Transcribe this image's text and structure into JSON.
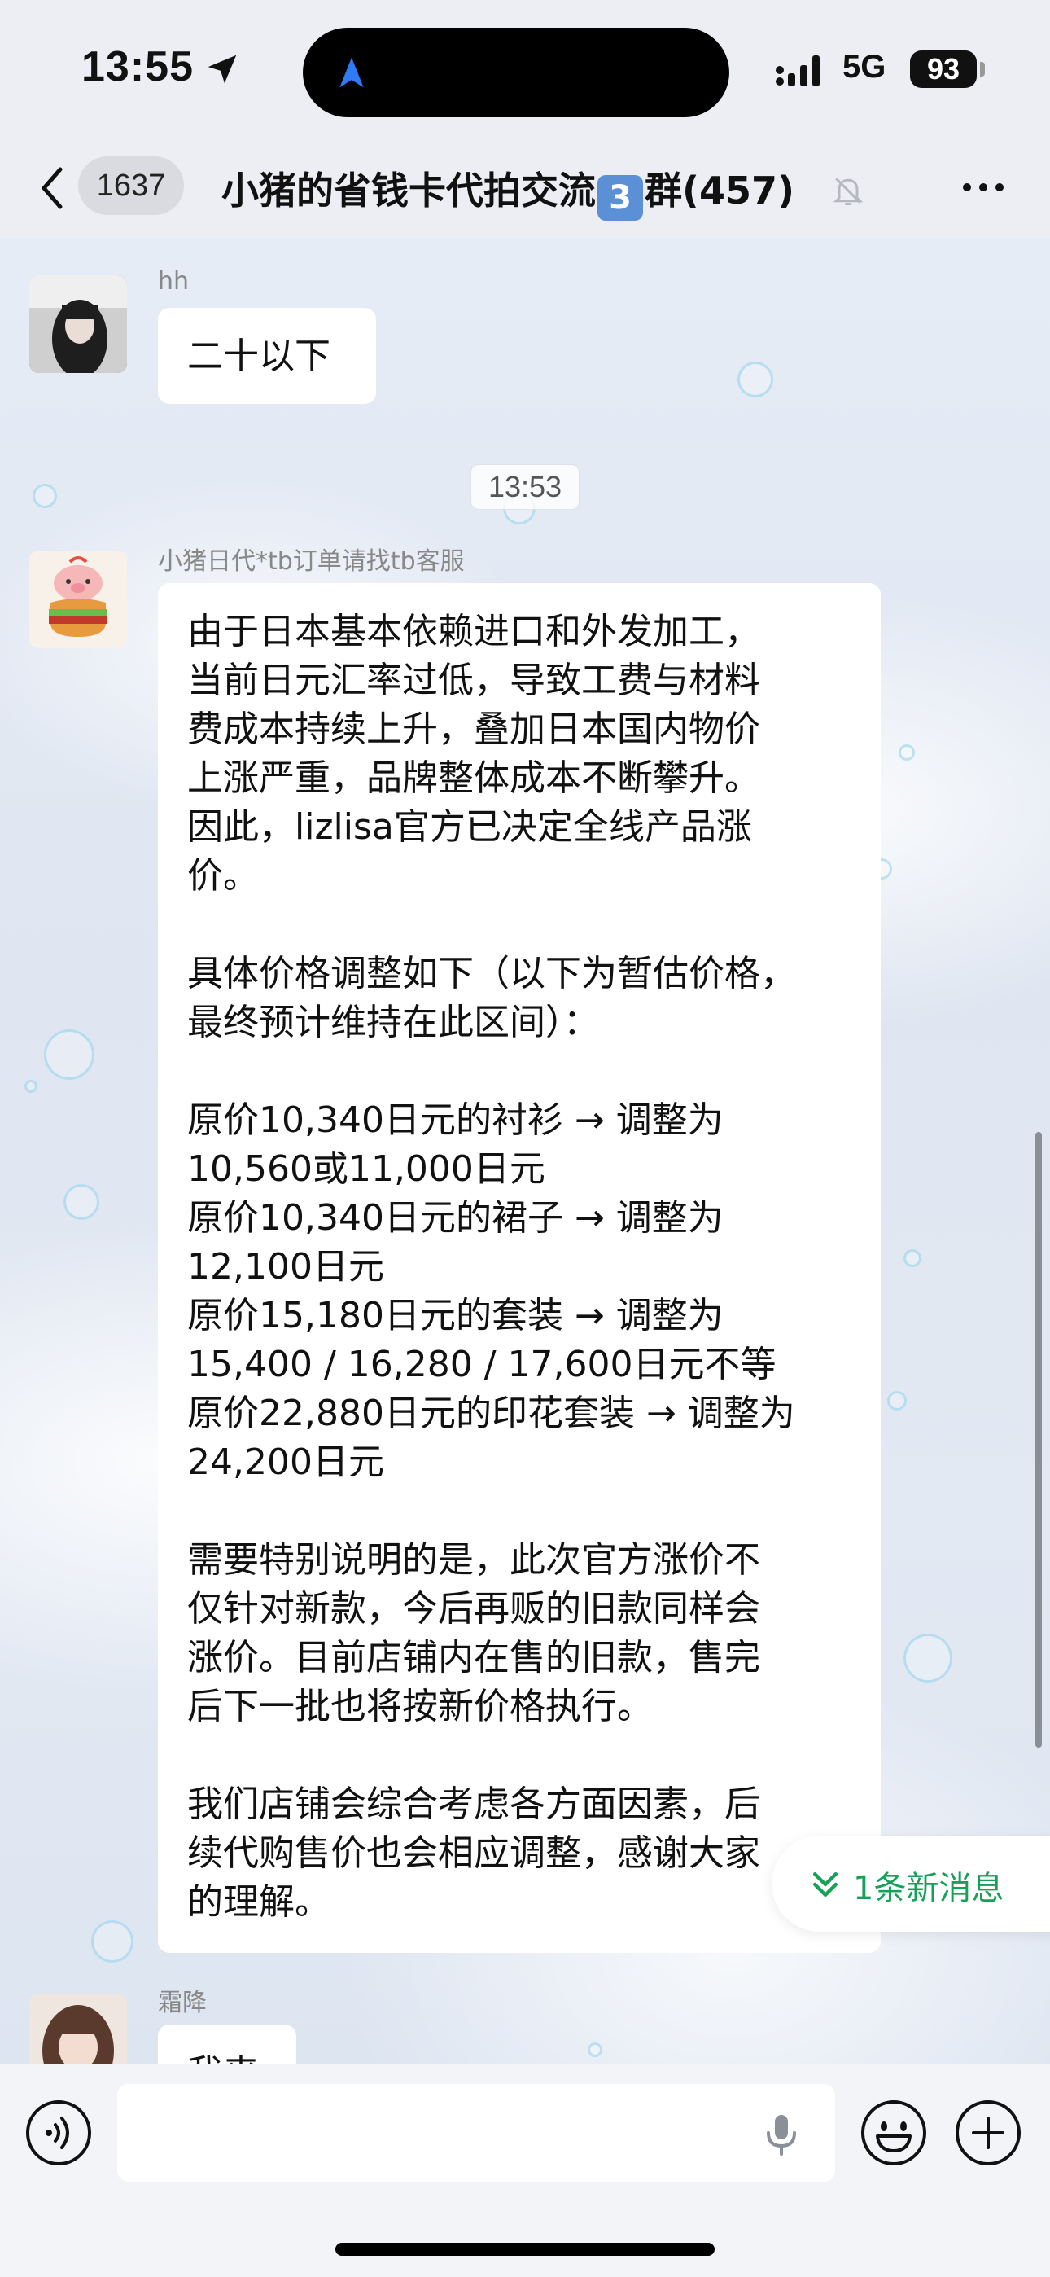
{
  "status_bar": {
    "time": "13:55",
    "network": "5G",
    "battery": "93"
  },
  "header": {
    "unread_count": "1637",
    "title_prefix": "小猪的省钱卡代拍交流",
    "title_badge": "3",
    "title_suffix": "群(457)"
  },
  "messages": [
    {
      "sender": "hh",
      "lines": [
        "二十以下"
      ]
    },
    {
      "timestamp": "13:53"
    },
    {
      "sender": "小猪日代*tb订单请找tb客服",
      "lines": [
        "由于日本基本依赖进口和外发加工，",
        "当前日元汇率过低，导致工费与材料",
        "费成本持续上升，叠加日本国内物价",
        "上涨严重，品牌整体成本不断攀升。",
        "因此，lizlisa官方已决定全线产品涨",
        "价。",
        "",
        "具体价格调整如下（以下为暂估价格，",
        "最终预计维持在此区间）：",
        "",
        "原价10,340日元的衬衫 → 调整为",
        "10,560或11,000日元",
        "原价10,340日元的裙子 → 调整为",
        "12,100日元",
        "原价15,180日元的套装 → 调整为",
        "15,400 / 16,280 / 17,600日元不等",
        "原价22,880日元的印花套装 → 调整为",
        "24,200日元",
        "",
        "需要特别说明的是，此次官方涨价不",
        "仅针对新款，今后再贩的旧款同样会",
        "涨价。目前店铺内在售的旧款，售完",
        "后下一批也将按新价格执行。",
        "",
        "我们店铺会综合考虑各方面因素，后",
        "续代购售价也会相应调整，感谢大家",
        "的理解。"
      ]
    },
    {
      "sender": "霜降",
      "lines": [
        "我来"
      ]
    }
  ],
  "new_messages_label": "1条新消息",
  "icons": {
    "back": "chevron-left-icon",
    "mute": "bell-slash-icon",
    "more": "ellipsis-icon",
    "voice": "voice-icon",
    "mic": "microphone-icon",
    "emoji": "emoji-icon",
    "plus": "plus-icon",
    "location": "location-arrow-icon",
    "signal": "cellular-signal-icon"
  },
  "colors": {
    "accent_green": "#18a058",
    "header_bg": "#eceef3",
    "bubble_bg": "#ffffff",
    "title_badge": "#5b8fd6"
  }
}
